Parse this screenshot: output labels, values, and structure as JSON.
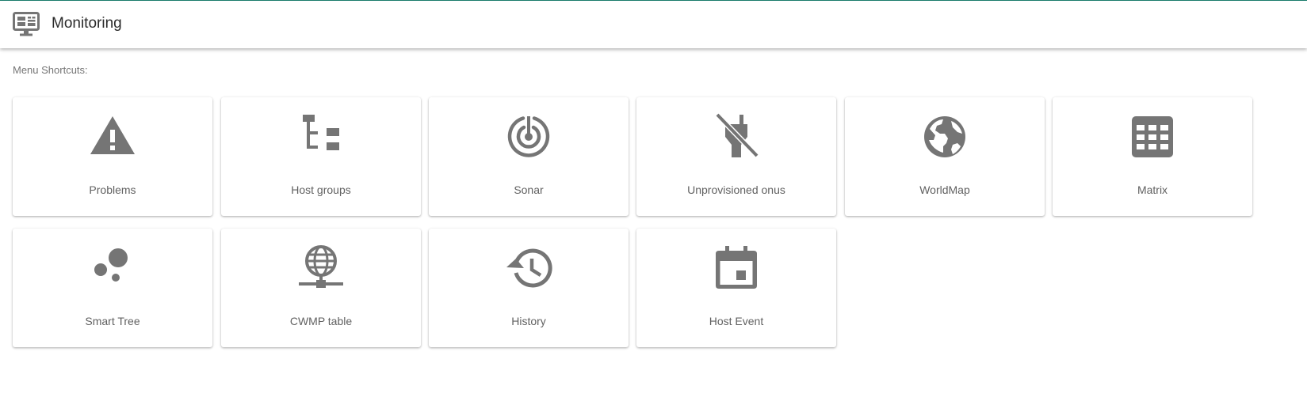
{
  "header": {
    "title": "Monitoring",
    "icon": "monitor-dashboard-icon"
  },
  "shortcuts_label": "Menu Shortcuts:",
  "colors": {
    "accent_line": "#1a7f6e",
    "icon_gray": "#757575",
    "label_gray": "#616161"
  },
  "cards": [
    {
      "label": "Problems",
      "icon": "warning-icon"
    },
    {
      "label": "Host groups",
      "icon": "tree-structure-icon"
    },
    {
      "label": "Sonar",
      "icon": "sonar-icon"
    },
    {
      "label": "Unprovisioned onus",
      "icon": "power-plug-off-icon"
    },
    {
      "label": "WorldMap",
      "icon": "globe-icon"
    },
    {
      "label": "Matrix",
      "icon": "grid-icon"
    },
    {
      "label": "Smart Tree",
      "icon": "bubbles-icon"
    },
    {
      "label": "CWMP table",
      "icon": "web-network-icon"
    },
    {
      "label": "History",
      "icon": "history-icon"
    },
    {
      "label": "Host Event",
      "icon": "calendar-event-icon"
    }
  ]
}
